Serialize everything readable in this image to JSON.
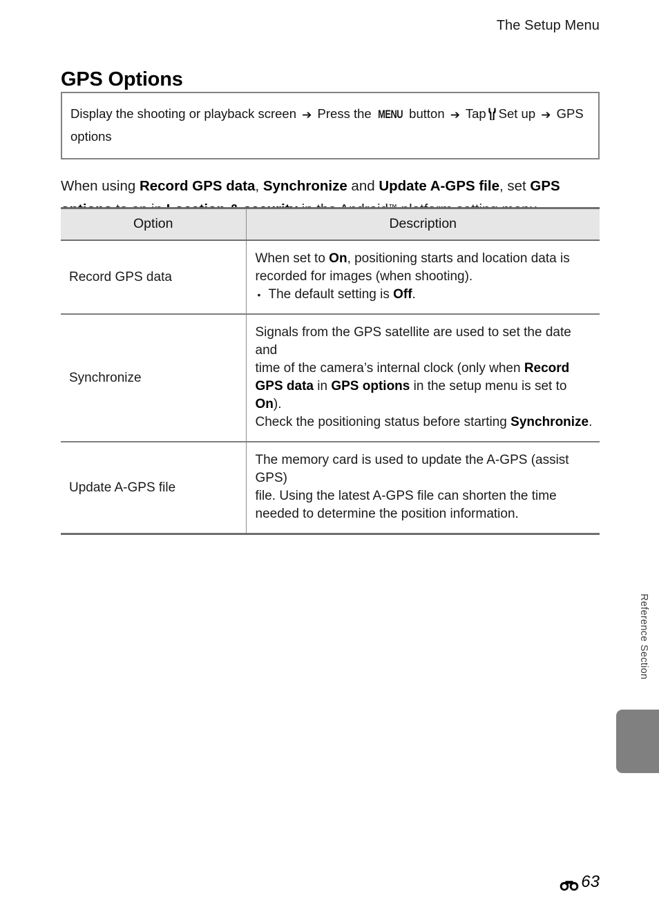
{
  "header": {
    "running_title": "The Setup Menu"
  },
  "section": {
    "title": "GPS Options"
  },
  "nav_box": {
    "step_1": "Display the shooting or playback screen",
    "arrow_1": "➔",
    "step_2_pre": "Press the",
    "menu_button_icon": "MENU",
    "step_2_post": "button",
    "arrow_2": "➔",
    "step_3_pre": "Tap",
    "setup_icon": "wrench-icon",
    "step_3_post": "Set up",
    "arrow_3": "➔",
    "step_4": "GPS options"
  },
  "intro": {
    "part_1": "When using ",
    "bold_1": "Record GPS data",
    "part_2": ", ",
    "bold_2": "Synchronize",
    "part_3": " and ",
    "bold_3": "Update A-GPS file",
    "part_4": ", set ",
    "bold_4": "GPS options",
    "part_5": " to on in ",
    "bold_5": "Location & security",
    "part_6": " in the Android",
    "trademark": "™",
    "part_7": " platform setting menu."
  },
  "table": {
    "headers": {
      "option": "Option",
      "description": "Description"
    },
    "rows": [
      {
        "option": "Record GPS data",
        "desc_line_1_a": "When set to ",
        "desc_line_1_b": "On",
        "desc_line_1_c": ", positioning starts and location data is",
        "desc_line_2": "recorded for images (when shooting).",
        "bullet_dot": "•",
        "bullet_a": "The default setting is ",
        "bullet_b": "Off",
        "bullet_c": "."
      },
      {
        "option": "Synchronize",
        "desc_line_1": "Signals from the GPS satellite are used to set the date and",
        "desc_line_2_a": "time of the camera’s internal clock (only when ",
        "desc_line_2_b": "Record",
        "desc_line_3_a": "GPS data",
        "desc_line_3_b": " in ",
        "desc_line_3_c": "GPS options",
        "desc_line_3_d": " in the setup menu is set to ",
        "desc_line_3_e": "On",
        "desc_line_3_f": ").",
        "desc_line_4_a": "Check the positioning status before starting ",
        "desc_line_4_b": "Synchronize",
        "desc_line_4_c": "."
      },
      {
        "option": "Update A-GPS file",
        "desc_line_1": "The memory card is used to update the A-GPS (assist GPS)",
        "desc_line_2": "file. Using the latest A-GPS file can shorten the time",
        "desc_line_3": "needed to determine the position information."
      }
    ]
  },
  "side_tab": {
    "label": "Reference Section"
  },
  "footer": {
    "section_icon": "binoculars-icon",
    "page_number": "63"
  },
  "colors": {
    "table_header_bg": "#e6e6e6",
    "table_border": "#6e6e6e",
    "nav_box_border": "#828282",
    "side_tab": "#808080",
    "text": "#1a1a1a"
  }
}
